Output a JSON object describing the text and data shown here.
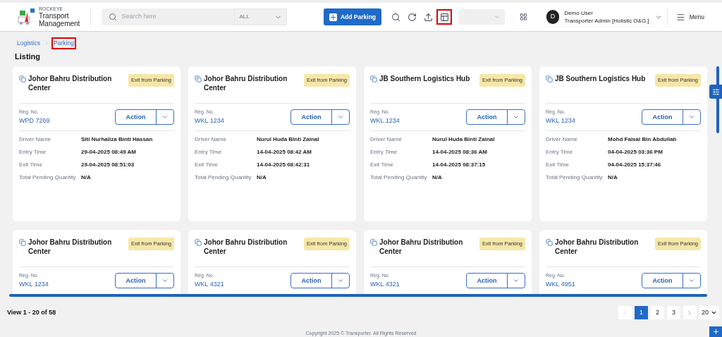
{
  "header": {
    "logo": {
      "brand": "ROCKEYE",
      "line1": "Transport",
      "line2": "Management"
    },
    "search": {
      "placeholder": "Search here",
      "filter": "ALL"
    },
    "add_button": "Add Parking",
    "toolbar_icons": [
      {
        "kind": "search",
        "highlighted": false
      },
      {
        "kind": "refresh",
        "highlighted": false
      },
      {
        "kind": "upload",
        "highlighted": false
      },
      {
        "kind": "layout",
        "highlighted": true
      }
    ],
    "user": {
      "avatar": "D",
      "name": "Demo User",
      "role": "Transporter Admin [Holistic O&G.]"
    },
    "menu": "Menu"
  },
  "breadcrumbs": [
    {
      "label": "Logistics",
      "highlighted": false
    },
    {
      "label": "Parking",
      "highlighted": true
    }
  ],
  "page_title": "Listing",
  "cards": [
    {
      "title": "Johor Bahru Distribution Center",
      "badge": "Exit from Parking",
      "reg_label": "Reg. No.",
      "reg_no": "WPD 7269",
      "action": "Action",
      "details": [
        {
          "label": "Driver Name",
          "value": "Siti Nurhaliza Binti Hassan"
        },
        {
          "label": "Entry Time",
          "value": "29-04-2025 08:49 AM"
        },
        {
          "label": "Exit Time",
          "value": "29-04-2025 08:51:03"
        },
        {
          "label": "Total Pending Quantity",
          "value": "N/A"
        }
      ]
    },
    {
      "title": "Johor Bahru Distribution Center",
      "badge": "Exit from Parking",
      "reg_label": "Reg. No.",
      "reg_no": "WKL 1234",
      "action": "Action",
      "details": [
        {
          "label": "Driver Name",
          "value": "Nurul Huda Binti Zainal"
        },
        {
          "label": "Entry Time",
          "value": "14-04-2025 08:42 AM"
        },
        {
          "label": "Exit Time",
          "value": "14-04-2025 08:42:31"
        },
        {
          "label": "Total Pending Quantity",
          "value": "N/A"
        }
      ]
    },
    {
      "title": "JB Southern Logistics Hub",
      "badge": "Exit from Parking",
      "reg_label": "Reg. No.",
      "reg_no": "WKL 1234",
      "action": "Action",
      "details": [
        {
          "label": "Driver Name",
          "value": "Nurul Huda Binti Zainal"
        },
        {
          "label": "Entry Time",
          "value": "14-04-2025 08:36 AM"
        },
        {
          "label": "Exit Time",
          "value": "14-04-2025 08:37:15"
        },
        {
          "label": "Total Pending Quantity",
          "value": "N/A"
        }
      ]
    },
    {
      "title": "JB Southern Logistics Hub",
      "badge": "Exit from Parking",
      "reg_label": "Reg. No.",
      "reg_no": "WKL 1234",
      "action": "Action",
      "details": [
        {
          "label": "Driver Name",
          "value": "Mohd Faisal Bin Abdullah"
        },
        {
          "label": "Entry Time",
          "value": "04-04-2025 03:36 PM"
        },
        {
          "label": "Exit Time",
          "value": "04-04-2025 15:37:46"
        },
        {
          "label": "Total Pending Quantity",
          "value": "N/A"
        }
      ]
    },
    {
      "title": "Johor Bahru Distribution Center",
      "badge": "Exit from Parking",
      "reg_label": "Reg. No.",
      "reg_no": "WKL 1234",
      "action": "Action"
    },
    {
      "title": "Johor Bahru Distribution Center",
      "badge": "Exit from Parking",
      "reg_label": "Reg. No.",
      "reg_no": "WKL 4321",
      "action": "Action"
    },
    {
      "title": "Johor Bahru Distribution Center",
      "badge": "Exit from Parking",
      "reg_label": "Reg. No.",
      "reg_no": "WKL 4321",
      "action": "Action"
    },
    {
      "title": "Johor Bahru Distribution Center",
      "badge": "Exit from Parking",
      "reg_label": "Reg. No.",
      "reg_no": "WKL 4951",
      "action": "Action"
    }
  ],
  "footer": {
    "summary": "View 1 - 20 of 58",
    "pages": [
      {
        "label": "1",
        "selected": true
      },
      {
        "label": "2",
        "selected": false
      },
      {
        "label": "3",
        "selected": false
      }
    ],
    "per_page": "20",
    "copyright": "Copyright 2025 © Transporter. All Rights Reserved"
  }
}
